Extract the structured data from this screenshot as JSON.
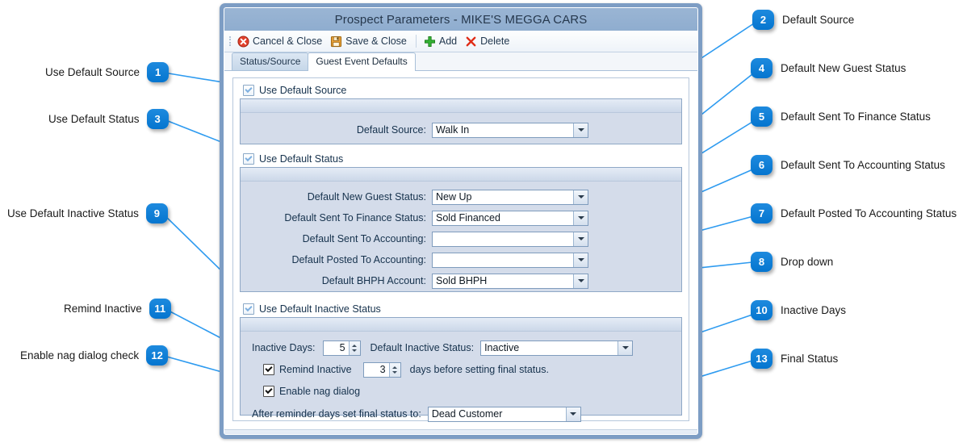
{
  "window": {
    "title": "Prospect Parameters - MIKE'S MEGGA CARS",
    "toolbar": {
      "cancel_close": "Cancel & Close",
      "save_close": "Save & Close",
      "add": "Add",
      "delete": "Delete"
    },
    "tabs": [
      {
        "label": "Status/Source",
        "active": false
      },
      {
        "label": "Guest Event Defaults",
        "active": true
      }
    ]
  },
  "sections": {
    "source": {
      "checkbox_label": "Use Default Source",
      "checked": true,
      "rows": [
        {
          "label": "Default Source:",
          "value": "Walk In"
        }
      ]
    },
    "status": {
      "checkbox_label": "Use Default Status",
      "checked": true,
      "rows": [
        {
          "label": "Default New Guest Status:",
          "value": "New Up"
        },
        {
          "label": "Default Sent To Finance Status:",
          "value": "Sold Financed"
        },
        {
          "label": "Default Sent To Accounting:",
          "value": ""
        },
        {
          "label": "Default Posted To Accounting:",
          "value": ""
        },
        {
          "label": "Default BHPH Account:",
          "value": "Sold BHPH"
        }
      ]
    },
    "inactive": {
      "checkbox_label": "Use Default Inactive Status",
      "checked": true,
      "inactive_days_label": "Inactive Days:",
      "inactive_days_value": "5",
      "default_inactive_status_label": "Default Inactive Status:",
      "default_inactive_status_value": "Inactive",
      "remind_inactive_label": "Remind Inactive",
      "remind_inactive_checked": true,
      "remind_days_value": "3",
      "remind_suffix": "days before setting final status.",
      "enable_nag_label": "Enable nag dialog",
      "enable_nag_checked": true,
      "final_status_label": "After reminder days set final status to:",
      "final_status_value": "Dead Customer"
    }
  },
  "callouts": {
    "accent_color": "#0b7fd6",
    "left": [
      {
        "n": "1",
        "text": "Use Default Source"
      },
      {
        "n": "3",
        "text": "Use Default Status"
      },
      {
        "n": "9",
        "text": "Use Default Inactive Status"
      },
      {
        "n": "11",
        "text": "Remind Inactive"
      },
      {
        "n": "12",
        "text": "Enable nag dialog check"
      }
    ],
    "right": [
      {
        "n": "2",
        "text": "Default Source"
      },
      {
        "n": "4",
        "text": "Default New Guest Status"
      },
      {
        "n": "5",
        "text": "Default Sent To Finance Status"
      },
      {
        "n": "6",
        "text": "Default Sent To Accounting Status"
      },
      {
        "n": "7",
        "text": "Default Posted To Accounting Status"
      },
      {
        "n": "8",
        "text": "Drop down"
      },
      {
        "n": "10",
        "text": "Inactive Days"
      },
      {
        "n": "13",
        "text": "Final Status"
      }
    ]
  }
}
